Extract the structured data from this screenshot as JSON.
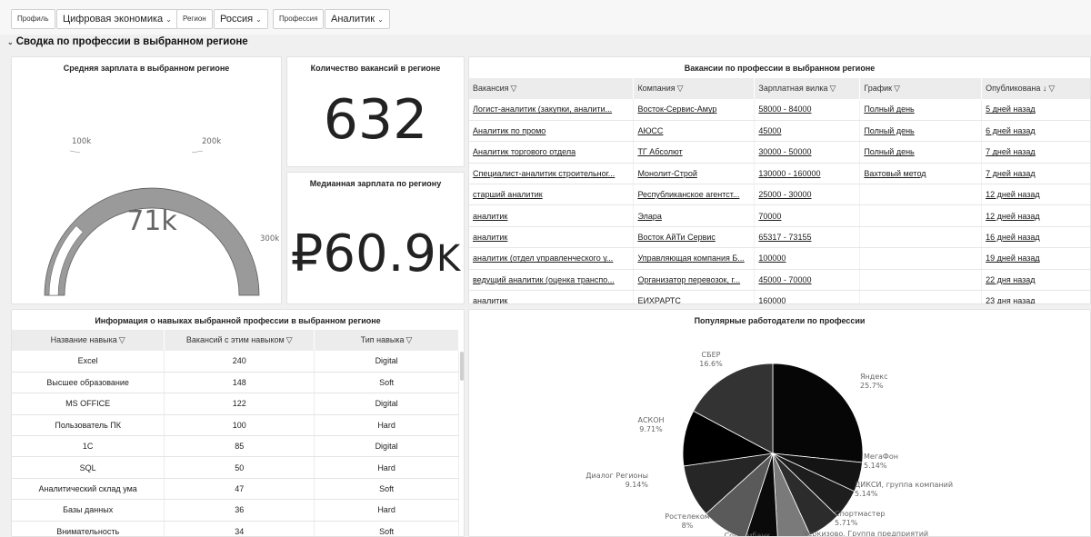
{
  "filters": {
    "profile_label": "Профиль",
    "profile_value": "Цифровая экономика",
    "region_label": "Регион",
    "region_value": "Россия",
    "profession_label": "Профессия",
    "profession_value": "Аналитик"
  },
  "section_title": "Сводка по профессии в выбранном регионе",
  "salary_gauge": {
    "title": "Средняя зарплата в выбранном регионе",
    "value_label": "71k",
    "value": 71000,
    "max": 300000,
    "ticks": [
      "100k",
      "200k",
      "300k"
    ]
  },
  "vacancy_count": {
    "title": "Количество вакансий в регионе",
    "value": "632"
  },
  "median_salary": {
    "title": "Медианная зарплата по региону",
    "value": "₽60.9",
    "suffix": "K"
  },
  "vacancies": {
    "title": "Вакансии по профессии в выбранном регионе",
    "columns": [
      "Вакансия",
      "Компания",
      "Зарплатная вилка",
      "График",
      "Опубликована"
    ],
    "sort_indicator": "↓",
    "rows": [
      [
        "Логист-аналитик (закупки, аналити...",
        "Восток-Сервис-Амур",
        "58000 - 84000",
        "Полный день",
        "5 дней назад"
      ],
      [
        "Аналитик по промо",
        "АЮСС",
        "45000",
        "Полный день",
        "6 дней назад"
      ],
      [
        "Аналитик торгового отдела",
        "ТГ Абсолют",
        "30000 - 50000",
        "Полный день",
        "7 дней назад"
      ],
      [
        "Специалист-аналитик строительног...",
        "Монолит-Строй",
        "130000 - 160000",
        "Вахтовый метод",
        "7 дней назад"
      ],
      [
        "старший аналитик",
        "Республиканское агентст...",
        "25000 - 30000",
        "",
        "12 дней назад"
      ],
      [
        "аналитик",
        "Элара",
        "70000",
        "",
        "12 дней назад"
      ],
      [
        "аналитик",
        "Восток АйТи Сервис",
        "65317 - 73155",
        "",
        "16 дней назад"
      ],
      [
        "аналитик (отдел управленческого у...",
        "Управляющая компания Б...",
        "100000",
        "",
        "19 дней назад"
      ],
      [
        "ведущий аналитик (оценка транспо...",
        "Организатор перевозок, г...",
        "45000 - 70000",
        "",
        "22 дня назад"
      ],
      [
        "аналитик",
        "ЕИХРАРТС",
        "160000",
        "",
        "23 дня назад"
      ]
    ]
  },
  "skills": {
    "title": "Информация о навыках выбранной профессии в выбранном регионе",
    "columns": [
      "Название навыка",
      "Вакансий с этим навыком",
      "Тип навыка"
    ],
    "rows": [
      [
        "Excel",
        "240",
        "Digital"
      ],
      [
        "Высшее образование",
        "148",
        "Soft"
      ],
      [
        "MS OFFICE",
        "122",
        "Digital"
      ],
      [
        "Пользователь ПК",
        "100",
        "Hard"
      ],
      [
        "1С",
        "85",
        "Digital"
      ],
      [
        "SQL",
        "50",
        "Hard"
      ],
      [
        "Аналитический склад ума",
        "47",
        "Soft"
      ],
      [
        "Базы данных",
        "36",
        "Hard"
      ],
      [
        "Внимательность",
        "34",
        "Soft"
      ]
    ]
  },
  "employers": {
    "title": "Популярные работодатели по профессии",
    "slices": [
      {
        "name": "Яндекс",
        "label": "25.7%",
        "value": 25.7,
        "color": "#060606"
      },
      {
        "name": "МегаФон",
        "label": "5.14%",
        "value": 5.14,
        "color": "#141414"
      },
      {
        "name": "ДИКСИ, группа компаний",
        "label": "5.14%",
        "value": 5.14,
        "color": "#1e1e1e"
      },
      {
        "name": "Спортмастер",
        "label": "5.71%",
        "value": 5.71,
        "color": "#2c2c2c"
      },
      {
        "name": "Черкизово, Группа предприятий",
        "label": "",
        "value": 5.71,
        "color": "#7a7a7a"
      },
      {
        "name": "Совкомбанк",
        "label": "",
        "value": 5.71,
        "color": "#0a0a0a"
      },
      {
        "name": "Ростелеком",
        "label": "8%",
        "value": 8.0,
        "color": "#5a5a5a"
      },
      {
        "name": "Диалог Регионы",
        "label": "9.14%",
        "value": 9.14,
        "color": "#262626"
      },
      {
        "name": "АСКОН",
        "label": "9.71%",
        "value": 9.71,
        "color": "#000000"
      },
      {
        "name": "СБЕР",
        "label": "16.6%",
        "value": 16.6,
        "color": "#333333"
      }
    ]
  },
  "colors": {
    "gauge_track": "#9a9a9a",
    "gauge_fill": "#ffffff",
    "header_bg": "#ececec",
    "panel_bg": "#ffffff",
    "page_bg": "#f0f0f0"
  }
}
